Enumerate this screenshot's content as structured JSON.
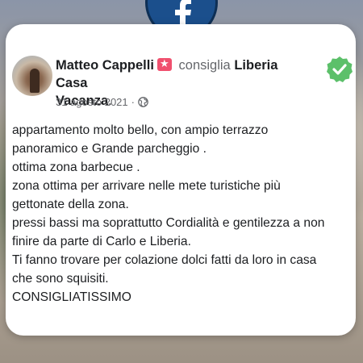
{
  "post": {
    "author": "Matteo Cappelli",
    "recommends_label": "consiglia",
    "page_name_line1": "Liberia Casa",
    "page_name_line2": "Vacanza",
    "date": "31 agosto 2021",
    "separator": "·",
    "lines": [
      "appartamento molto bello, con ampio terrazzo",
      "panoramico e Grande parcheggio .",
      "ottima zona barbecue .",
      "zona ottima per arrivare nelle mete turistiche più",
      "gettonate della zona.",
      "pressi bassi ma soprattutto Cordialità e gentilezza a non",
      "finire da parte di Carlo e Liberia.",
      "Ti fanno trovare per colazione dolci fatti da loro in casa",
      "che sono squisiti.",
      "CONSIGLIATISSIMO"
    ]
  },
  "icons": {
    "facebook": "facebook-logo-icon",
    "badge": "recommendation-star-icon",
    "globe": "globe-icon",
    "check": "verified-check-icon"
  },
  "colors": {
    "facebook_blue": "#1b4f8c",
    "check_green": "#5cc06a",
    "badge_pink": "#f0506e"
  }
}
